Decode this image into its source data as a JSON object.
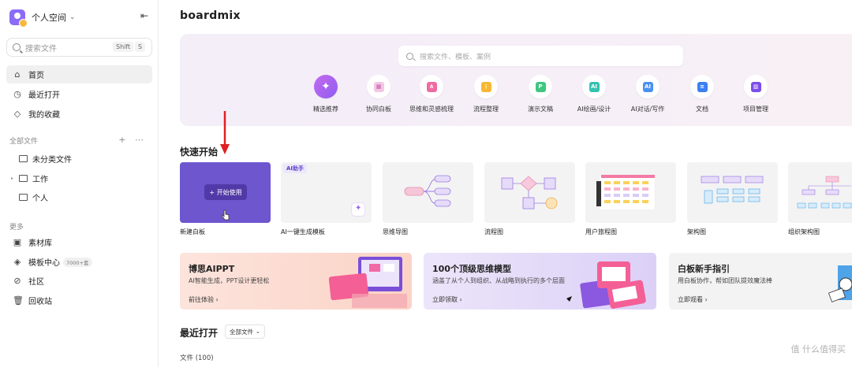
{
  "sidebar": {
    "space_name": "个人空间",
    "search_placeholder": "搜索文件",
    "shortcut_shift": "Shift",
    "shortcut_s": "S",
    "nav": [
      {
        "label": "首页",
        "icon": "home-icon"
      },
      {
        "label": "最近打开",
        "icon": "clock-icon"
      },
      {
        "label": "我的收藏",
        "icon": "tag-icon"
      }
    ],
    "all_files_label": "全部文件",
    "folders": [
      {
        "label": "未分类文件"
      },
      {
        "label": "工作"
      },
      {
        "label": "个人"
      }
    ],
    "more_label": "更多",
    "more_items": [
      {
        "label": "素材库",
        "icon": "image-icon"
      },
      {
        "label": "模板中心",
        "icon": "template-icon",
        "badge": "7000+套"
      },
      {
        "label": "社区",
        "icon": "community-icon"
      },
      {
        "label": "回收站",
        "icon": "trash-icon"
      }
    ]
  },
  "main": {
    "logo": "boardmix",
    "hero_search_placeholder": "搜索文件、模板、案例",
    "categories": [
      {
        "label": "精选推荐",
        "icon": "sparkle-icon"
      },
      {
        "label": "协同白板",
        "icon": "whiteboard-icon"
      },
      {
        "label": "思维和灵感梳理",
        "icon": "mindmap-icon"
      },
      {
        "label": "流程整理",
        "icon": "flow-icon"
      },
      {
        "label": "演示文稿",
        "icon": "presentation-icon"
      },
      {
        "label": "AI绘画/设计",
        "icon": "ai-paint-icon"
      },
      {
        "label": "AI对话/写作",
        "icon": "ai-chat-icon"
      },
      {
        "label": "文档",
        "icon": "doc-icon"
      },
      {
        "label": "项目管理",
        "icon": "project-icon"
      }
    ],
    "quick_start_title": "快速开始",
    "start_button": "+ 开始使用",
    "ai_tag": "AI助手",
    "templates": [
      {
        "label": "新建白板"
      },
      {
        "label": "AI一键生成模板"
      },
      {
        "label": "思维导图"
      },
      {
        "label": "流程图"
      },
      {
        "label": "用户旅程图"
      },
      {
        "label": "架构图"
      },
      {
        "label": "组织架构图"
      }
    ],
    "banners": [
      {
        "title": "博思AIPPT",
        "subtitle": "AI智能生成，PPT设计更轻松",
        "link": "前往体验 ›"
      },
      {
        "title": "100个顶级思维模型",
        "subtitle": "涵盖了从个人到组织、从战略到执行的多个层面",
        "link": "立即领取 ›"
      },
      {
        "title": "白板新手指引",
        "subtitle": "用白板协作，帮如团队提效魔法棒",
        "link": "立即观看 ›"
      }
    ],
    "recent_title": "最近打开",
    "recent_filter": "全部文件",
    "files_count": "文件 (100)"
  },
  "watermark": "值 什么值得买",
  "colors": {
    "accent": "#6e56cf",
    "arrow": "#e02020"
  }
}
